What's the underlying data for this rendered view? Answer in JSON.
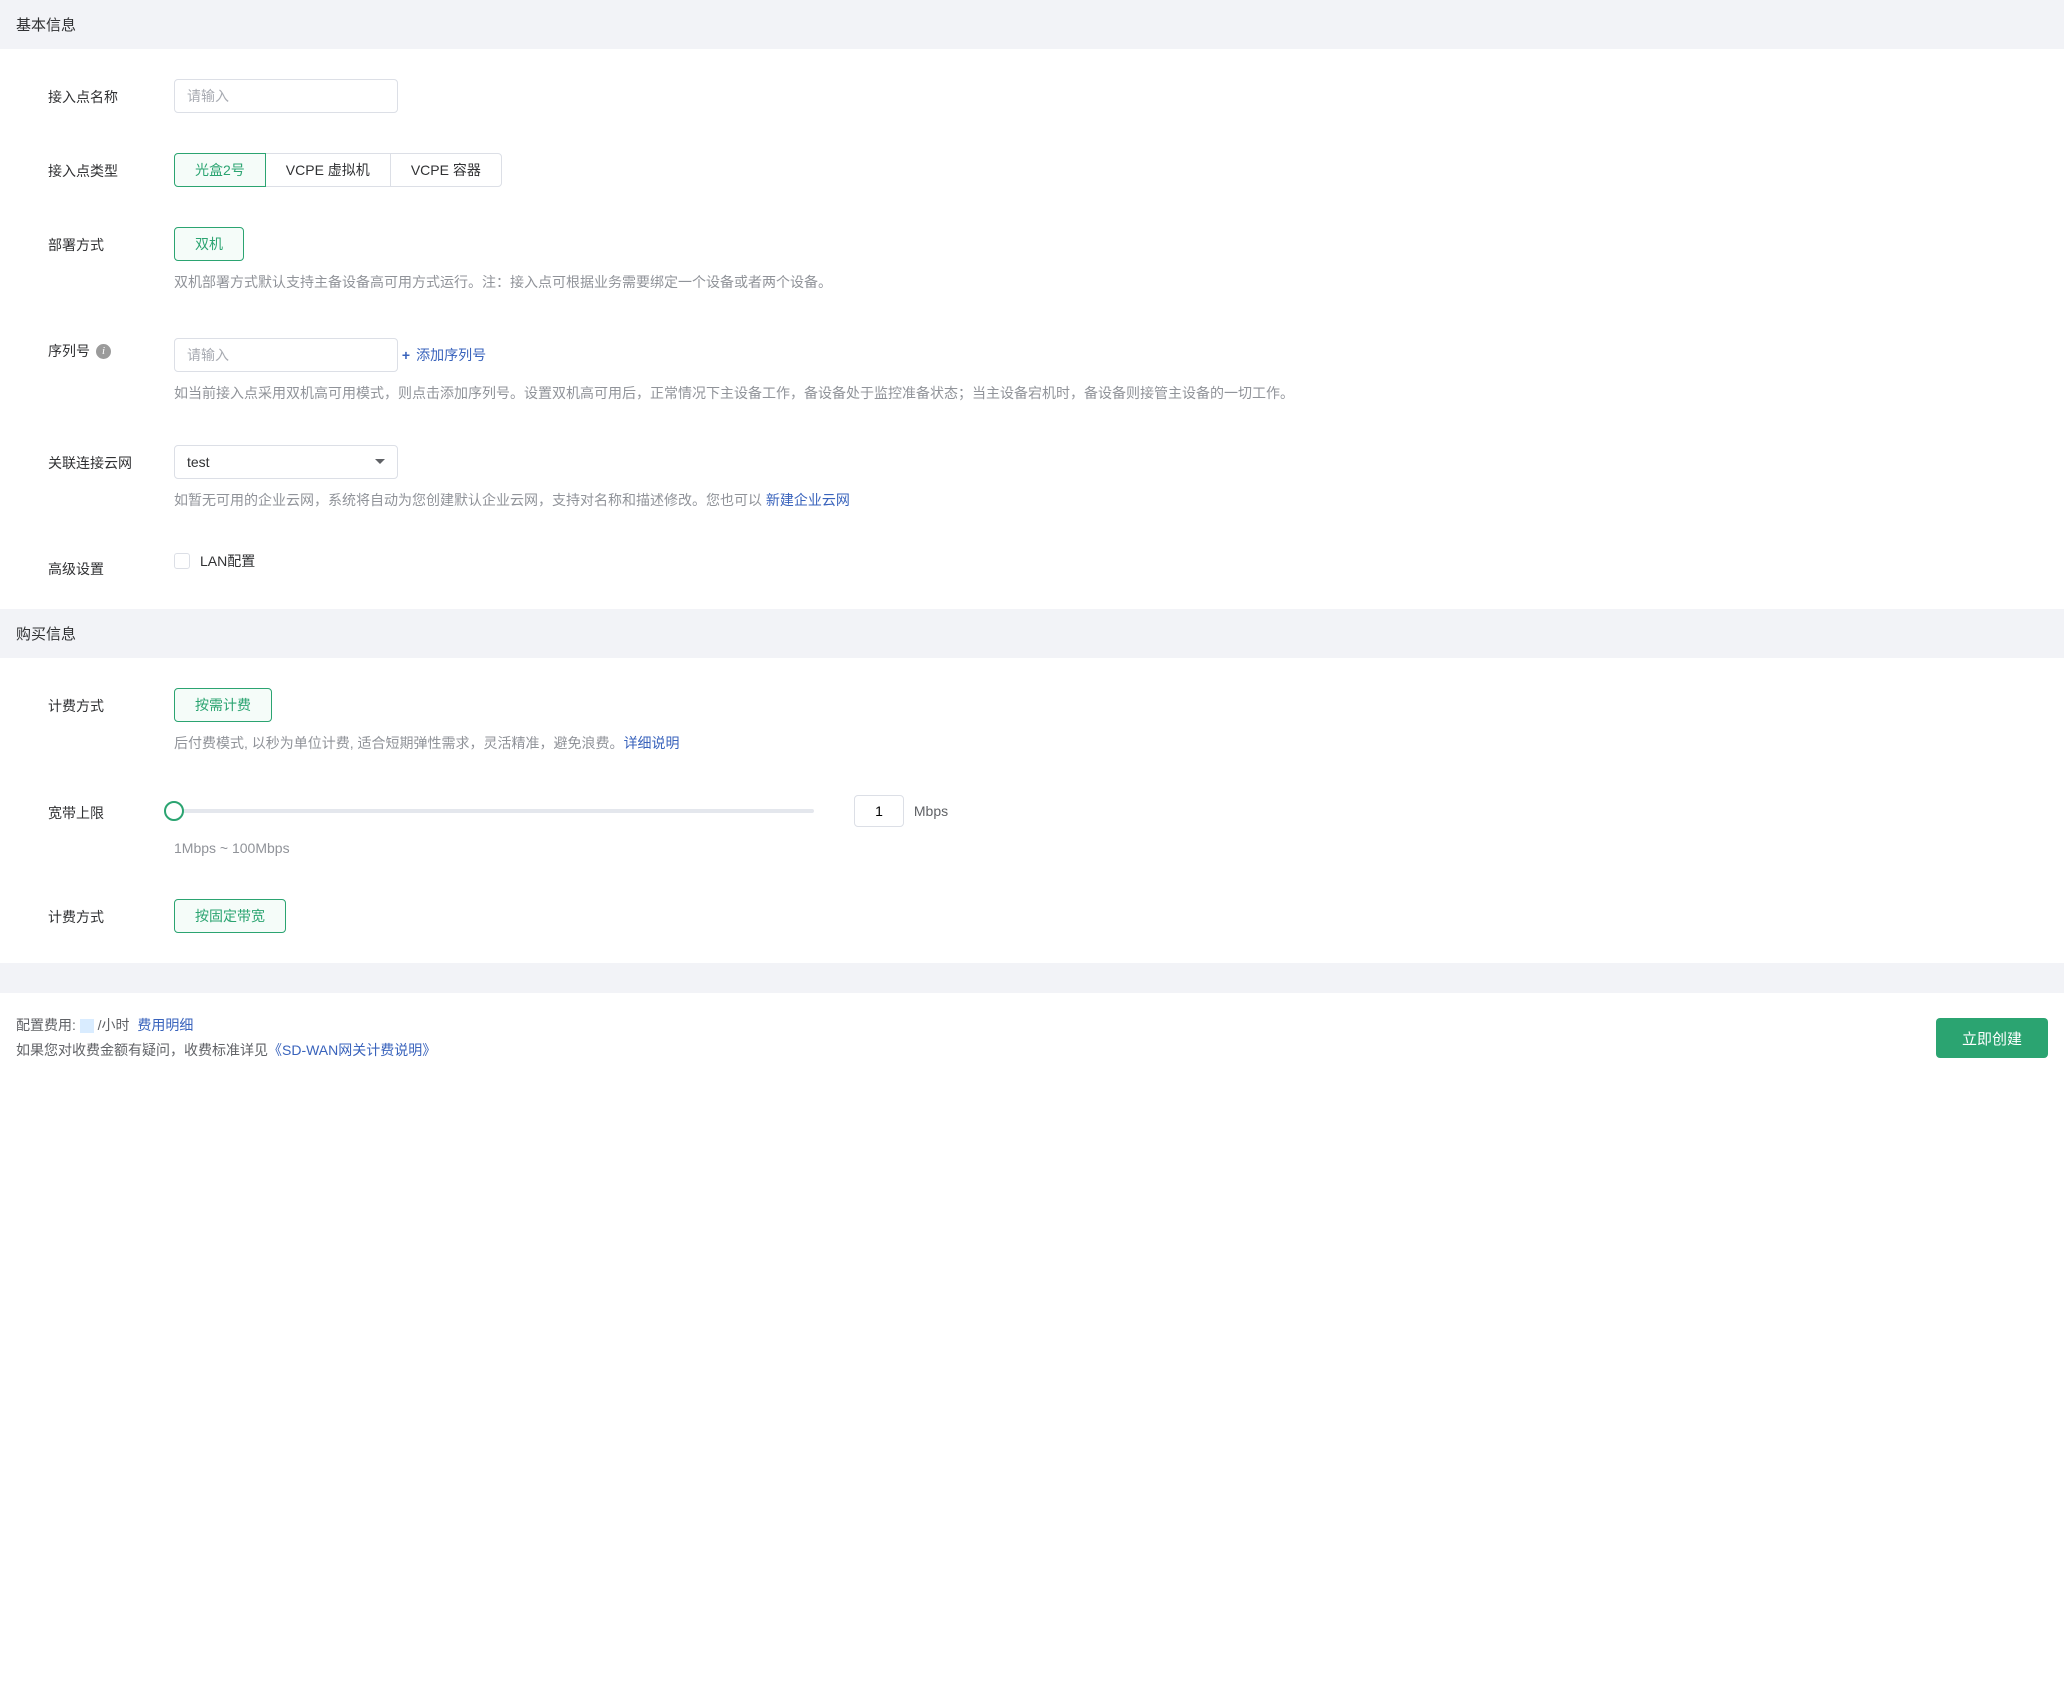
{
  "sections": {
    "basic": {
      "title": "基本信息",
      "fields": {
        "name": {
          "label": "接入点名称",
          "placeholder": "请输入"
        },
        "type": {
          "label": "接入点类型",
          "options": [
            "光盒2号",
            "VCPE 虚拟机",
            "VCPE 容器"
          ]
        },
        "deploy": {
          "label": "部署方式",
          "option": "双机",
          "hint": "双机部署方式默认支持主备设备高可用方式运行。注：接入点可根据业务需要绑定一个设备或者两个设备。"
        },
        "serial": {
          "label": "序列号",
          "placeholder": "请输入",
          "add_label": "添加序列号",
          "hint": "如当前接入点采用双机高可用模式，则点击添加序列号。设置双机高可用后，正常情况下主设备工作，备设备处于监控准备状态；当主设备宕机时，备设备则接管主设备的一切工作。"
        },
        "network": {
          "label": "关联连接云网",
          "value": "test",
          "hint_prefix": "如暂无可用的企业云网，系统将自动为您创建默认企业云网，支持对名称和描述修改。您也可以 ",
          "link": "新建企业云网"
        },
        "advanced": {
          "label": "高级设置",
          "checkbox_label": "LAN配置"
        }
      }
    },
    "purchase": {
      "title": "购买信息",
      "fields": {
        "billing": {
          "label": "计费方式",
          "option": "按需计费",
          "hint_prefix": "后付费模式, 以秒为单位计费, 适合短期弹性需求，灵活精准，避免浪费。",
          "link": "详细说明"
        },
        "bandwidth": {
          "label": "宽带上限",
          "value": "1",
          "unit": "Mbps",
          "hint": "1Mbps ~ 100Mbps"
        },
        "billing_mode": {
          "label": "计费方式",
          "option": "按固定带宽"
        }
      }
    }
  },
  "footer": {
    "cost_label": "配置费用: ",
    "per_hour": " /小时",
    "detail_link": "费用明细",
    "question_prefix": "如果您对收费金额有疑问，收费标准详见",
    "doc_link": "《SD-WAN网关计费说明》",
    "create_btn": "立即创建"
  }
}
